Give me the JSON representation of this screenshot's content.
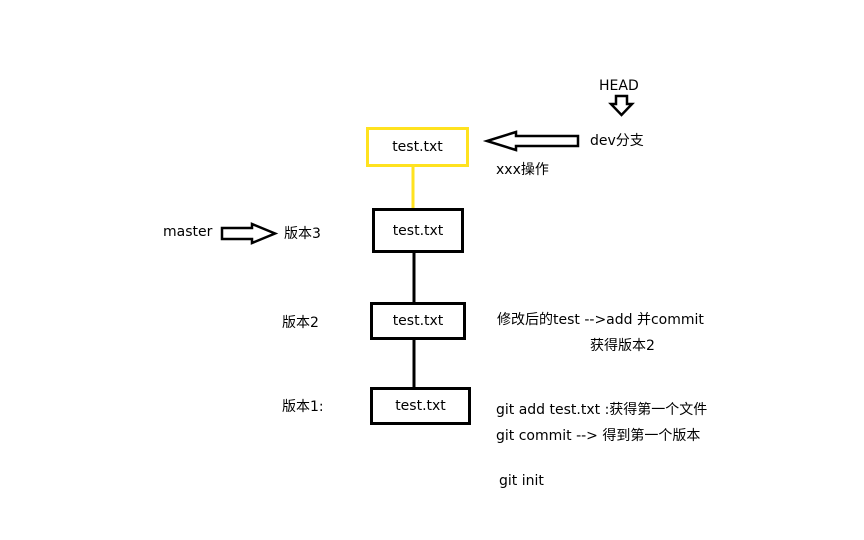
{
  "head_label": "HEAD",
  "branches": {
    "dev": "dev分支",
    "master": "master"
  },
  "versions": {
    "v3": "版本3",
    "v2": "版本2",
    "v1": "版本1:"
  },
  "nodes": {
    "dev_commit": "test.txt",
    "v3": "test.txt",
    "v2": "test.txt",
    "v1": "test.txt"
  },
  "notes": {
    "xxx": "xxx操作",
    "modify_line1": "修改后的test  -->add 并commit",
    "modify_line2": "获得版本2",
    "add_line": "git add test.txt :获得第一个文件",
    "commit_line": "git commit  --> 得到第一个版本",
    "init": "git init"
  },
  "colors": {
    "highlight": "#ffe21f",
    "stroke": "#000000"
  }
}
